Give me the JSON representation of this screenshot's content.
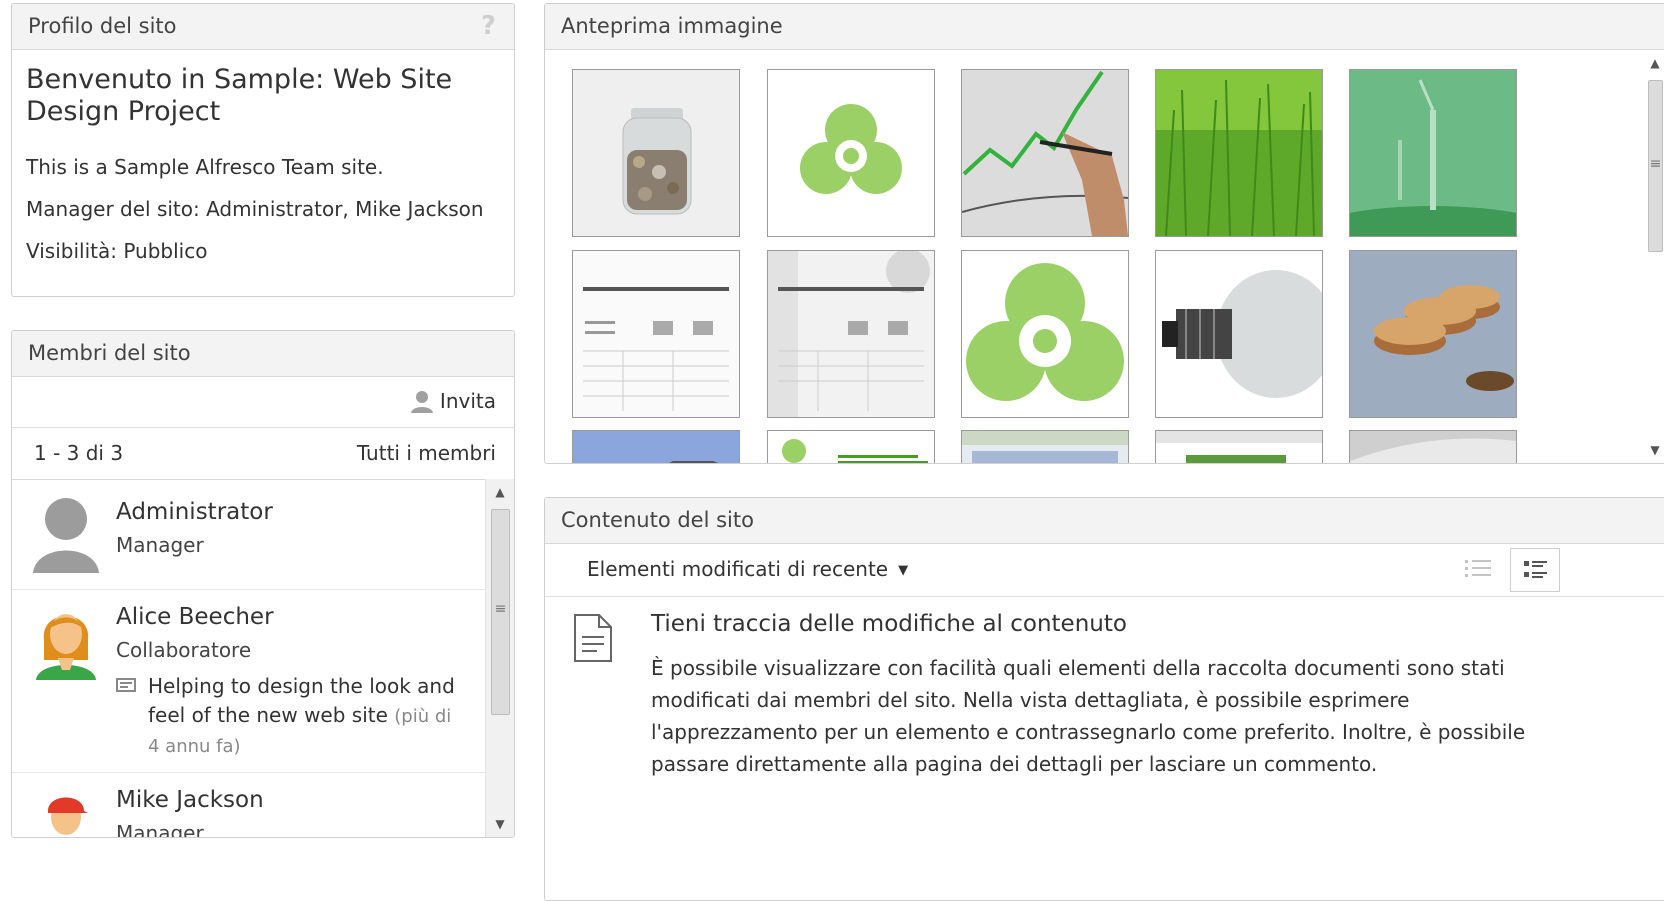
{
  "site_profile": {
    "title": "Profilo del sito",
    "help_icon": "?",
    "heading": "Benvenuto in Sample: Web Site Design Project",
    "description": "This is a Sample Alfresco Team site.",
    "manager_line": "Manager del sito: Administrator, Mike Jackson",
    "visibility_line": "Visibilità: Pubblico"
  },
  "site_members": {
    "title": "Membri del sito",
    "invite_label": "Invita",
    "paging": "1 - 3 di 3",
    "all_members_label": "Tutti i membri",
    "members": [
      {
        "name": "Administrator",
        "role": "Manager",
        "avatar": "default-user-icon"
      },
      {
        "name": "Alice Beecher",
        "role": "Collaboratore",
        "avatar": "alice-avatar",
        "status": "Helping to design the look and feel of the new web site",
        "status_date": "(più di 4 annu fa)"
      },
      {
        "name": "Mike Jackson",
        "role": "Manager",
        "avatar": "mike-avatar"
      }
    ]
  },
  "image_preview": {
    "title": "Anteprima immagine",
    "thumbnails": [
      {
        "name": "coins-jar"
      },
      {
        "name": "green-logo"
      },
      {
        "name": "growth-chart"
      },
      {
        "name": "grass"
      },
      {
        "name": "wind-turbine"
      },
      {
        "name": "invoice-form"
      },
      {
        "name": "invoice-form-2"
      },
      {
        "name": "green-logo-large"
      },
      {
        "name": "light-bulb"
      },
      {
        "name": "coin-stacks"
      },
      {
        "name": "blue-image"
      },
      {
        "name": "green-energy-doc"
      },
      {
        "name": "web-page-1"
      },
      {
        "name": "web-page-2"
      },
      {
        "name": "gray-image"
      }
    ]
  },
  "site_content": {
    "title": "Contenuto del sito",
    "filter_label": "Elementi modificati di recente",
    "heading": "Tieni traccia delle modifiche al contenuto",
    "description": "È possibile visualizzare con facilità quali elementi della raccolta documenti sono stati modificati dai membri del sito. Nella vista dettagliata, è possibile esprimere l'apprezzamento per un elemento e contrassegnarlo come preferito. Inoltre, è possibile passare direttamente alla pagina dei dettagli per lasciare un commento."
  },
  "colors": {
    "accent_green": "#8cc63f",
    "title_bar": "#f3f3f3",
    "border": "#cfcfcf"
  }
}
